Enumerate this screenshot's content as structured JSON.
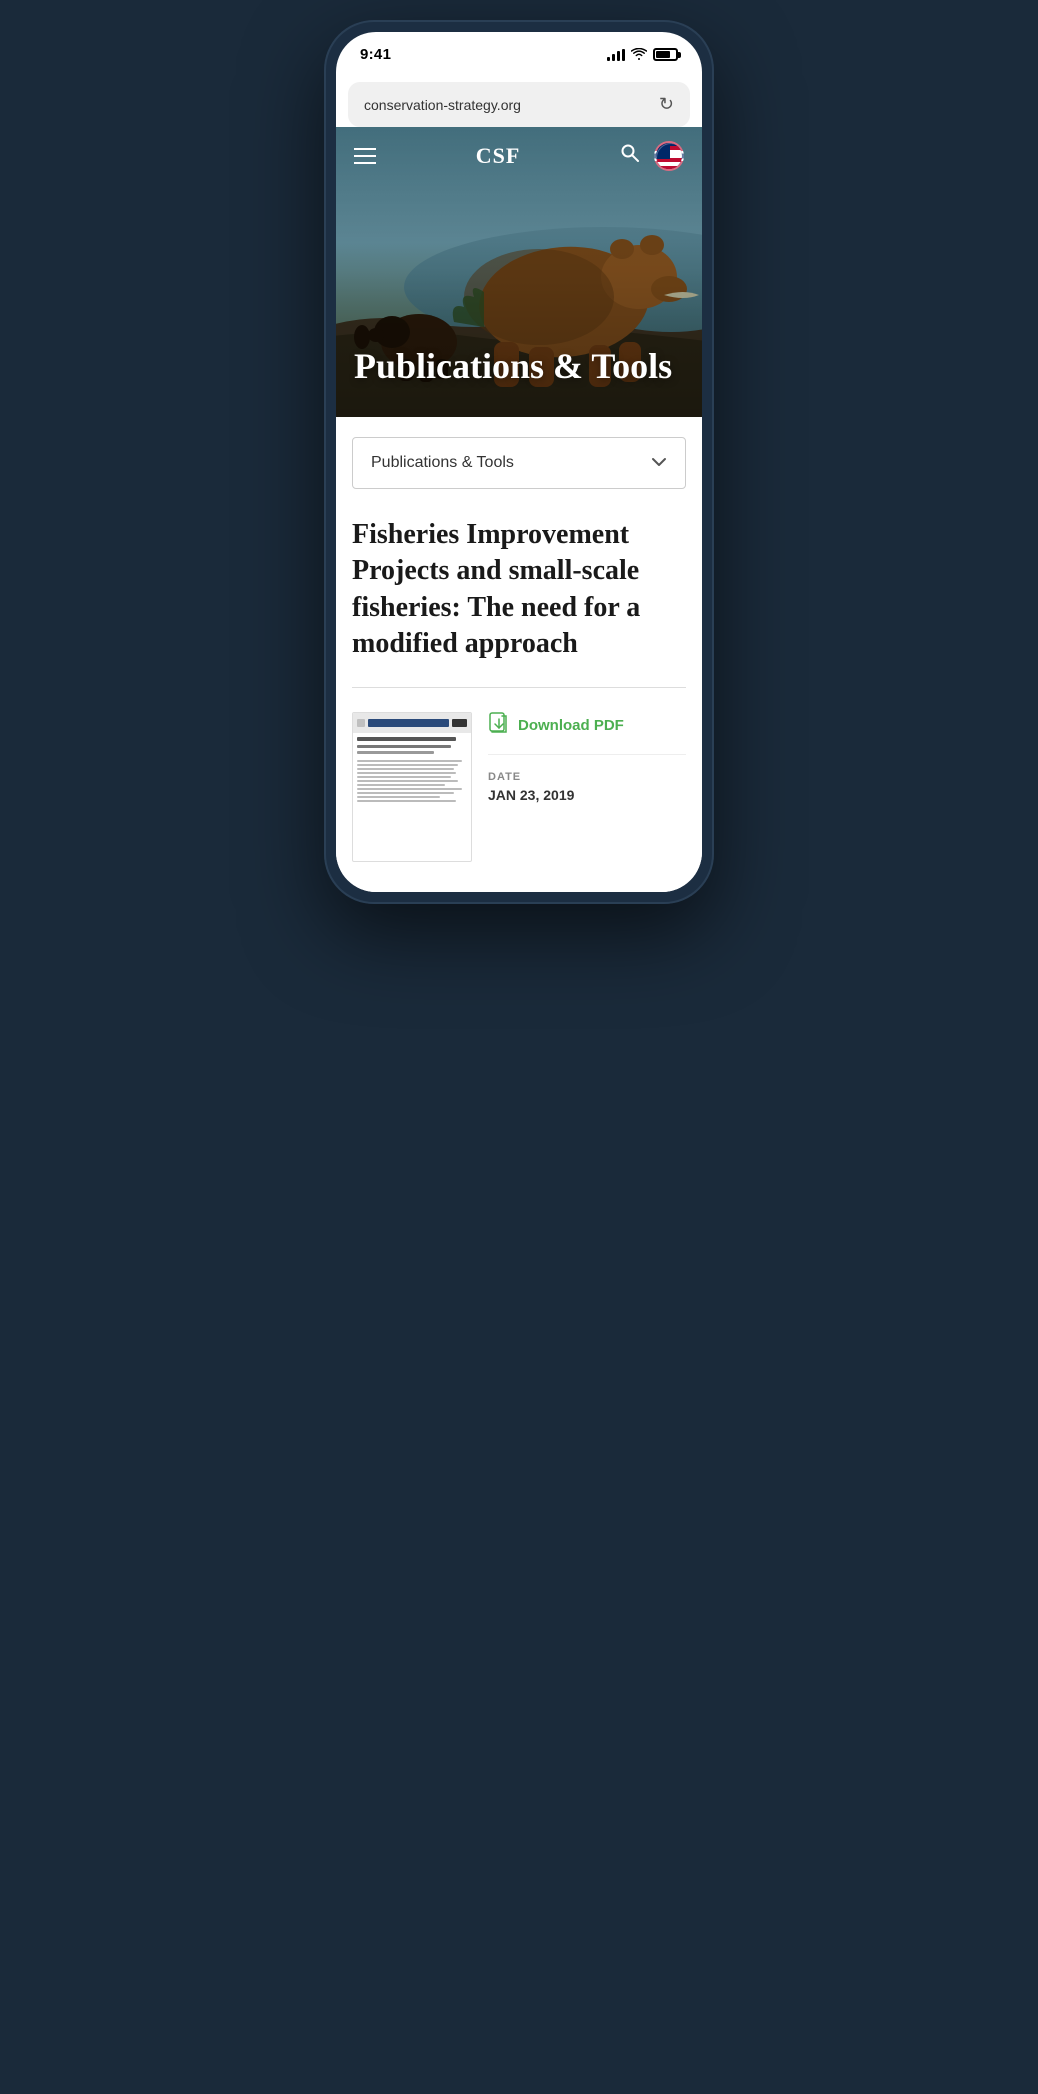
{
  "status_bar": {
    "time": "9:41",
    "battery_level": "75%"
  },
  "browser": {
    "url": "conservation-strategy.org",
    "refresh_label": "↻"
  },
  "nav": {
    "logo": "CSF",
    "hamburger_label": "Menu",
    "search_label": "Search",
    "flag_label": "US Flag"
  },
  "hero": {
    "title": "Publications & Tools"
  },
  "dropdown": {
    "label": "Publications & Tools",
    "chevron": "∨"
  },
  "article": {
    "title": "Fisheries Improvement Projects and small-scale fisheries: The need for a modified approach",
    "download_pdf_label": "Download PDF",
    "date_label": "DATE",
    "date_value": "JAN 23, 2019"
  },
  "thumbnail": {
    "lines": [
      "long",
      "long",
      "medium",
      "long",
      "short",
      "long",
      "medium",
      "long",
      "long",
      "short",
      "medium",
      "long"
    ]
  }
}
